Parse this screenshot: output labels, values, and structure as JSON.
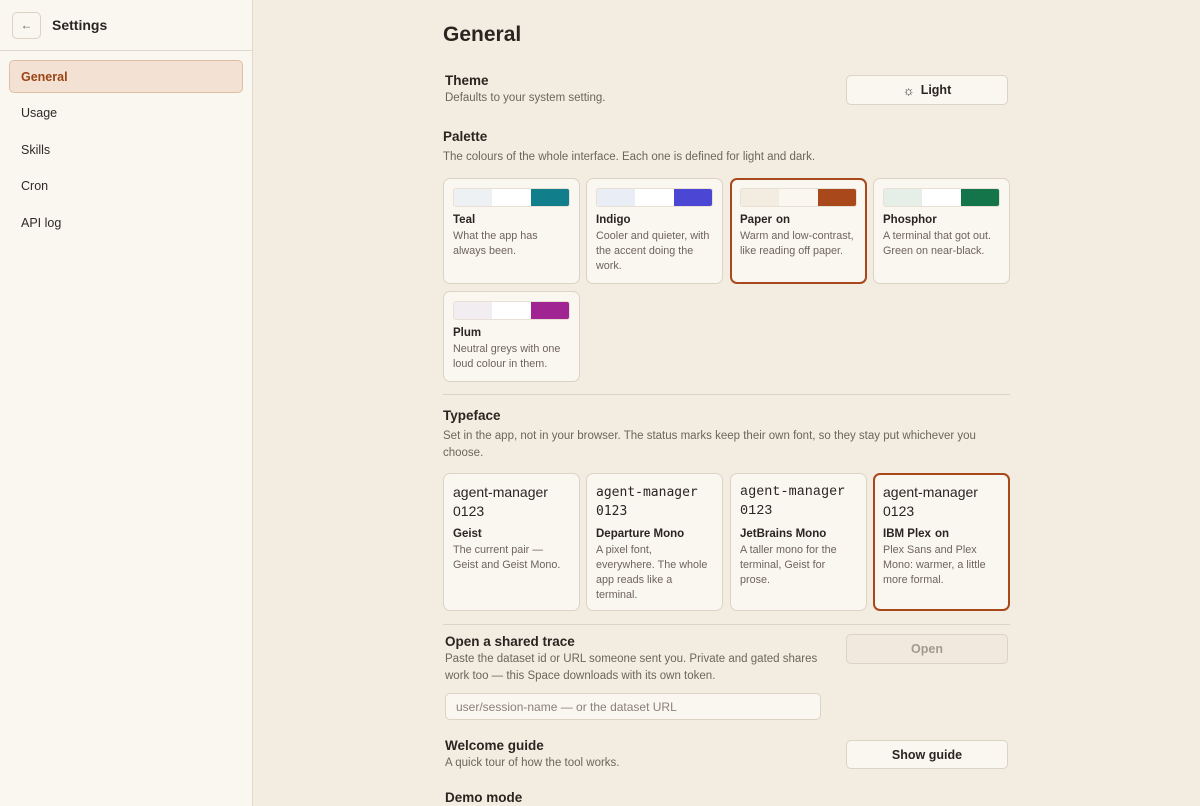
{
  "sidebar": {
    "back_icon": "←",
    "title": "Settings",
    "items": [
      {
        "label": "General",
        "active": true
      },
      {
        "label": "Usage"
      },
      {
        "label": "Skills"
      },
      {
        "label": "Cron"
      },
      {
        "label": "API log"
      }
    ]
  },
  "page": {
    "title": "General"
  },
  "theme": {
    "title": "Theme",
    "desc": "Defaults to your system setting.",
    "button_icon": "☼",
    "button_label": "Light"
  },
  "palette": {
    "title": "Palette",
    "desc": "The colours of the whole interface. Each one is defined for light and dark.",
    "options": [
      {
        "name": "Teal",
        "desc": "What the app has always been.",
        "colors": [
          "#eef1f3",
          "#ffffff",
          "#117f8b"
        ],
        "selected": false
      },
      {
        "name": "Indigo",
        "desc": "Cooler and quieter, with the accent doing the work.",
        "colors": [
          "#e9edf5",
          "#ffffff",
          "#4b46d4"
        ],
        "selected": false
      },
      {
        "name": "Paper",
        "on": "on",
        "desc": "Warm and low-contrast, like reading off paper.",
        "colors": [
          "#f3ece1",
          "#faf6f0",
          "#a9481b"
        ],
        "selected": true
      },
      {
        "name": "Phosphor",
        "desc": "A terminal that got out. Green on near-black.",
        "colors": [
          "#e5efe8",
          "#ffffff",
          "#14744a"
        ],
        "selected": false
      },
      {
        "name": "Plum",
        "desc": "Neutral greys with one loud colour in them.",
        "colors": [
          "#f1edf0",
          "#ffffff",
          "#a02592"
        ],
        "selected": false
      }
    ]
  },
  "typeface": {
    "title": "Typeface",
    "desc": "Set in the app, not in your browser. The status marks keep their own font, so they stay put whichever you choose.",
    "options": [
      {
        "sample1": "agent-manager",
        "sample2": "0123",
        "name": "Geist",
        "desc": "The current pair — Geist and Geist Mono.",
        "selected": false
      },
      {
        "sample1": "agent-manager",
        "sample2": "0123",
        "name": "Departure Mono",
        "desc": "A pixel font, everywhere. The whole app reads like a terminal.",
        "selected": false
      },
      {
        "sample1": "agent-manager",
        "sample2": "0123",
        "name": "JetBrains Mono",
        "desc": "A taller mono for the terminal, Geist for prose.",
        "selected": false
      },
      {
        "sample1": "agent-manager",
        "sample2": "0123",
        "name": "IBM Plex",
        "on": "on",
        "desc": "Plex Sans and Plex Mono: warmer, a little more formal.",
        "selected": true
      }
    ]
  },
  "trace": {
    "title": "Open a shared trace",
    "desc": "Paste the dataset id or URL someone sent you. Private and gated shares work too — this Space downloads with its own token.",
    "placeholder": "user/session-name — or the dataset URL",
    "value": "",
    "button_label": "Open"
  },
  "guide": {
    "title": "Welcome guide",
    "desc": "A quick tour of how the tool works.",
    "button_label": "Show guide"
  },
  "demo": {
    "title": "Demo mode"
  }
}
